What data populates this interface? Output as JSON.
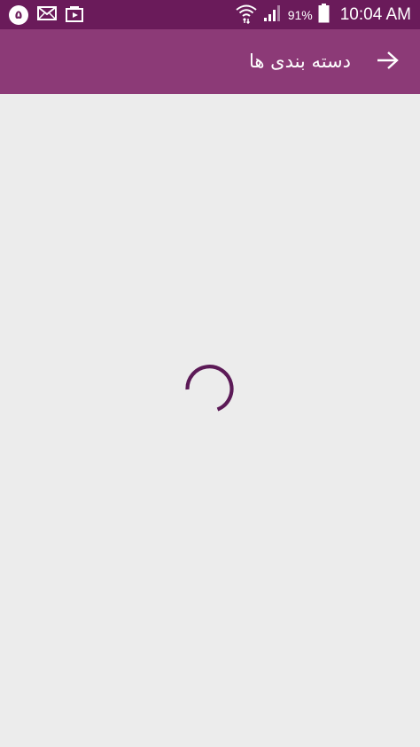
{
  "status_bar": {
    "notification_badge": "۵",
    "battery_percent": "91%",
    "time": "10:04 AM",
    "icons": [
      "mail-icon",
      "app-store-icon",
      "wifi-icon",
      "signal-icon",
      "battery-icon"
    ]
  },
  "toolbar": {
    "title": "دسته بندی ها",
    "back_icon": "arrow-forward-icon"
  },
  "colors": {
    "status_bar": "#6a1b5a",
    "toolbar": "#8c3a77",
    "background": "#ececec",
    "spinner": "#5c1a57"
  },
  "content": {
    "state": "loading"
  }
}
